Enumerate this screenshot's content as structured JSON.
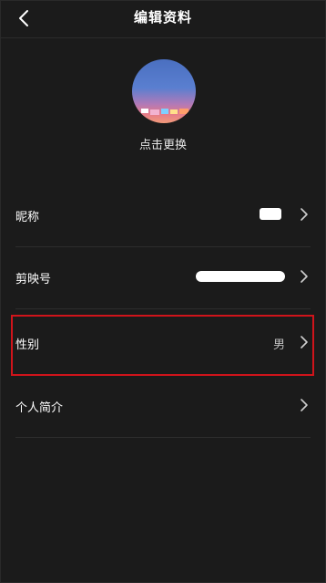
{
  "nav": {
    "title": "编辑资料",
    "back_icon": "chevron-left-icon"
  },
  "avatar": {
    "caption": "点击更换"
  },
  "rows": [
    {
      "label": "昵称",
      "value": "",
      "icon": "chevron-right-icon"
    },
    {
      "label": "剪映号",
      "value": "",
      "icon": "chevron-right-icon"
    },
    {
      "label": "性别",
      "value": "男",
      "icon": "chevron-right-icon"
    },
    {
      "label": "个人简介",
      "value": "",
      "icon": "chevron-right-icon"
    }
  ],
  "colors": {
    "background": "#1b1b1b",
    "highlight": "#d0141b"
  }
}
